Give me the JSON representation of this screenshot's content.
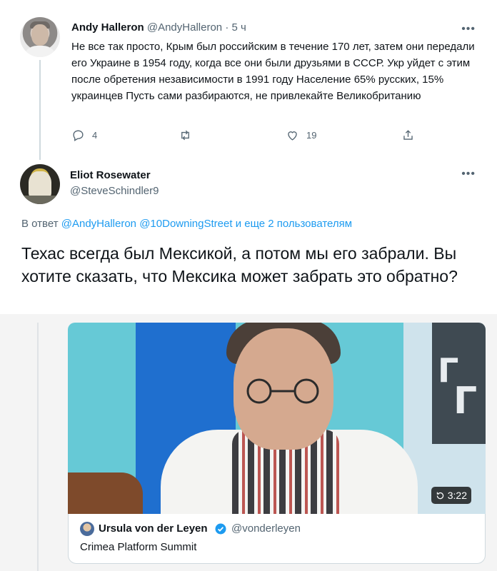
{
  "tweet1": {
    "author_name": "Andy Halleron",
    "author_handle": "@AndyHalleron",
    "separator": "·",
    "time": "5 ч",
    "body": "Не все так просто, Крым был российским в течение 170 лет, затем они передали его Украине в 1954 году, когда все они были друзьями в СССР. Укр уйдет с этим после обретения независимости в 1991 году Население 65% русских, 15% украинцев Пусть сами разбираются, не привлекайте Великобританию",
    "more": "•••",
    "actions": {
      "reply_icon": "reply-icon",
      "reply_count": "4",
      "retweet_icon": "retweet-icon",
      "like_icon": "heart-icon",
      "like_count": "19",
      "share_icon": "share-icon"
    }
  },
  "tweet2": {
    "author_name": "Eliot Rosewater",
    "author_handle": "@SteveSchindler9",
    "more": "•••",
    "reply_prefix": "В ответ",
    "reply_mentions": [
      "@AndyHalleron",
      "@10DowningStreet"
    ],
    "reply_suffix": "и еще 2 пользователям",
    "body": "Техас всегда был Мексикой, а потом мы его забрали. Вы хотите сказать, что Мексика может забрать это обратно?"
  },
  "video": {
    "duration": "3:22"
  },
  "quote": {
    "author_name": "Ursula von der Leyen",
    "author_handle": "@vonderleyen",
    "text": "Crimea Platform Summit"
  },
  "colors": {
    "link": "#1d9bf0",
    "secondary_text": "#536471",
    "primary_text": "#0f1419"
  }
}
